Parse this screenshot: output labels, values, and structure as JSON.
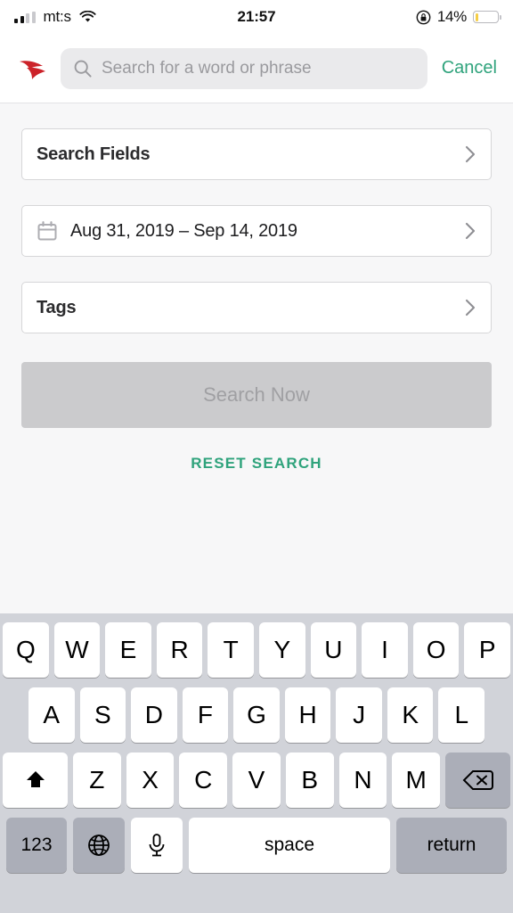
{
  "status_bar": {
    "carrier": "mt:s",
    "signal_bars_filled": 2,
    "signal_bars_total": 4,
    "wifi_icon": "wifi-icon",
    "time": "21:57",
    "orientation_lock_icon": "rotation-lock-icon",
    "battery_percent": "14%",
    "battery_level": 14,
    "battery_color": "#f6ce46"
  },
  "header": {
    "logo_icon": "red-arrow-logo",
    "logo_color": "#cc2229",
    "search": {
      "icon": "search-icon",
      "value": "",
      "placeholder": "Search for a word or phrase"
    },
    "cancel_label": "Cancel",
    "accent_color": "#2fa37c"
  },
  "form": {
    "rows": [
      {
        "label": "Search Fields",
        "icon": null,
        "chevron": "chevron-right-icon"
      },
      {
        "label": "Aug 31, 2019 – Sep 14, 2019",
        "icon": "calendar-icon",
        "chevron": "chevron-right-icon"
      },
      {
        "label": "Tags",
        "icon": null,
        "chevron": "chevron-right-icon"
      }
    ],
    "search_button": {
      "label": "Search Now",
      "disabled": true,
      "bg_color": "#cbcbcd",
      "text_color": "#a0a0a3"
    },
    "reset_label": "RESET SEARCH"
  },
  "keyboard": {
    "row1": [
      "Q",
      "W",
      "E",
      "R",
      "T",
      "Y",
      "U",
      "I",
      "O",
      "P"
    ],
    "row2": [
      "A",
      "S",
      "D",
      "F",
      "G",
      "H",
      "J",
      "K",
      "L"
    ],
    "row3": {
      "shift_icon": "shift-arrow-icon",
      "letters": [
        "Z",
        "X",
        "C",
        "V",
        "B",
        "N",
        "M"
      ],
      "backspace_icon": "backspace-icon"
    },
    "row4": {
      "numbers_label": "123",
      "globe_icon": "globe-icon",
      "mic_icon": "microphone-icon",
      "space_label": "space",
      "return_label": "return"
    }
  }
}
